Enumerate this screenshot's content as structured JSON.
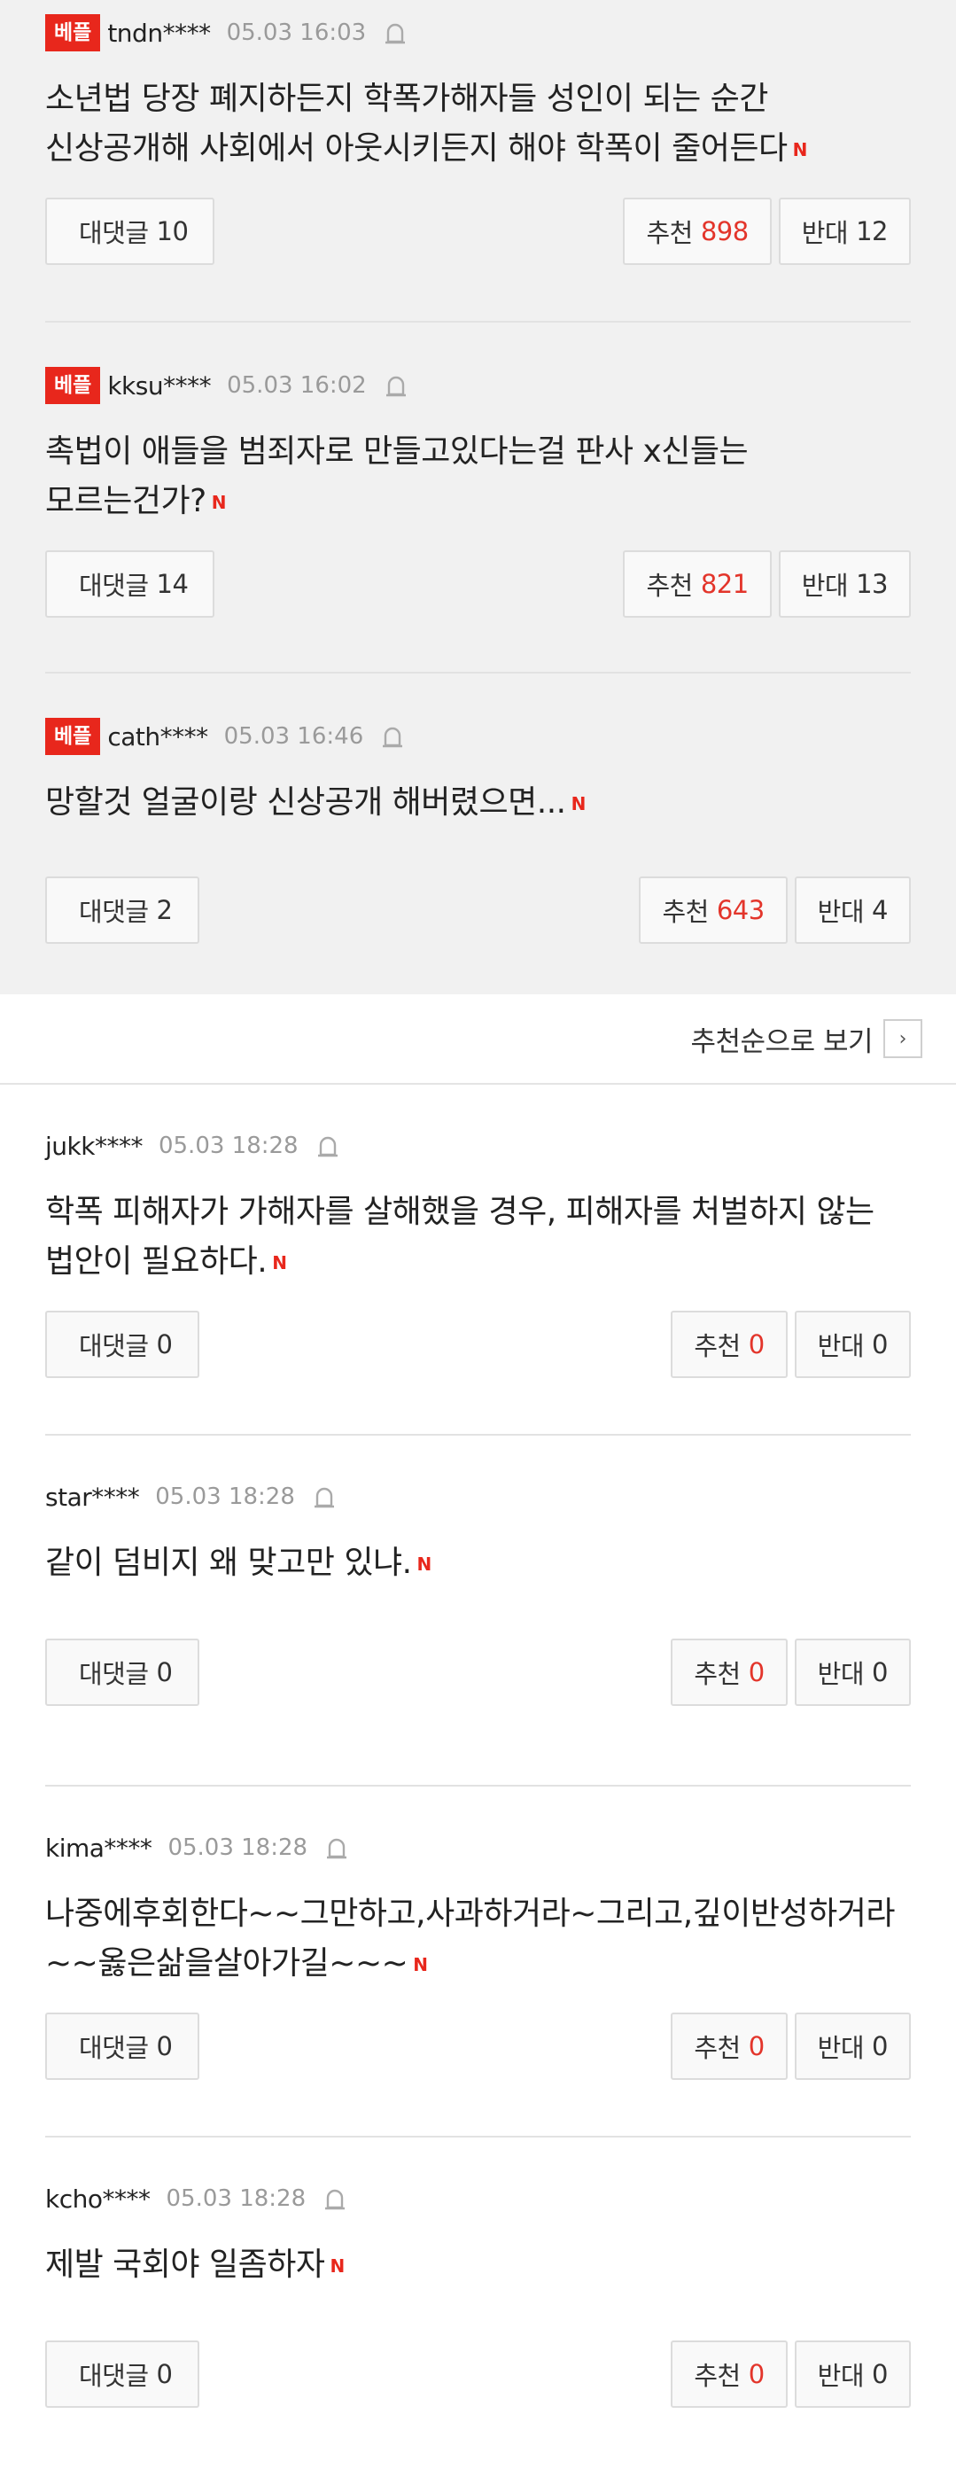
{
  "best_badge_label": "베플",
  "reply_label": "대댓글",
  "up_label": "추천",
  "down_label": "반대",
  "new_mark": "N",
  "sort_label": "추천순으로 보기",
  "sort_arrow": "›",
  "best_comments": [
    {
      "user": "tndn****",
      "time": "05.03 16:03",
      "text": "소년법 당장 폐지하든지 학폭가해자들 성인이 되는 순간 신상공개해 사회에서 아웃시키든지 해야 학폭이 줄어든다",
      "replies": "10",
      "up": "898",
      "down": "12"
    },
    {
      "user": "kksu****",
      "time": "05.03 16:02",
      "text": "촉법이 애들을 범죄자로 만들고있다는걸 판사 x신들는 모르는건가?",
      "replies": "14",
      "up": "821",
      "down": "13"
    },
    {
      "user": "cath****",
      "time": "05.03 16:46",
      "text": "망할것 얼굴이랑 신상공개 해버렸으면...",
      "replies": "2",
      "up": "643",
      "down": "4"
    }
  ],
  "comments": [
    {
      "user": "jukk****",
      "time": "05.03 18:28",
      "text": "학폭 피해자가 가해자를 살해했을 경우, 피해자를 처벌하지 않는 법안이 필요하다.",
      "replies": "0",
      "up": "0",
      "down": "0"
    },
    {
      "user": "star****",
      "time": "05.03 18:28",
      "text": "같이 덤비지 왜 맞고만 있냐.",
      "replies": "0",
      "up": "0",
      "down": "0"
    },
    {
      "user": "kima****",
      "time": "05.03 18:28",
      "text": "나중에후회한다~~그만하고,사과하거라~그리고,깊이반성하거라~~옳은삶을살아가길~~~",
      "replies": "0",
      "up": "0",
      "down": "0"
    },
    {
      "user": "kcho****",
      "time": "05.03 18:28",
      "text": "제발 국회야 일좀하자",
      "replies": "0",
      "up": "0",
      "down": "0"
    }
  ],
  "colors": {
    "accent": "#e8271c",
    "count_red": "#e3352b",
    "best_bg": "#f1f1f1"
  }
}
